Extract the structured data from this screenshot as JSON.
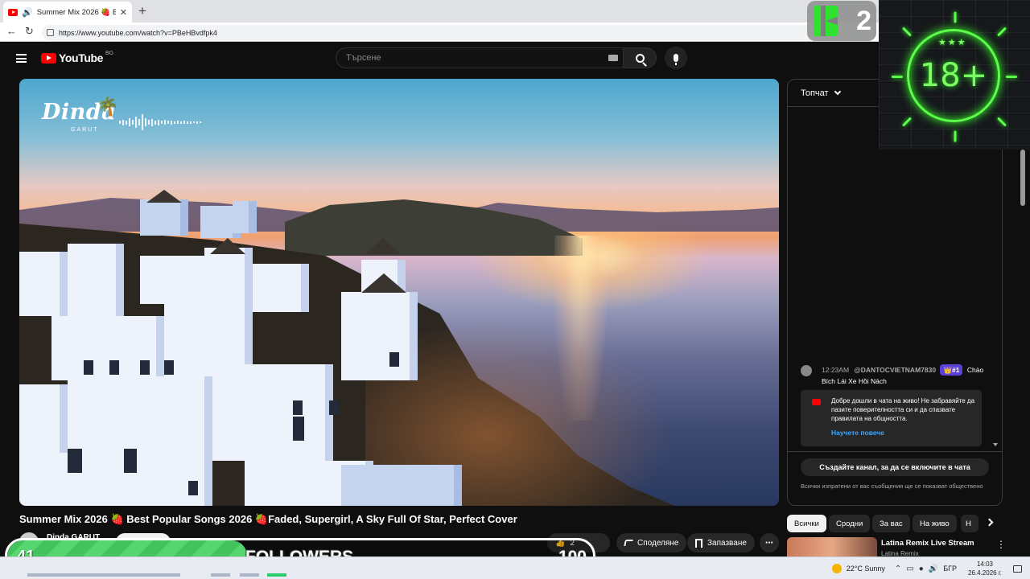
{
  "browser": {
    "tab_title": "Summer Mix 2026 🍓 Best Po",
    "tab_close": "✕",
    "new_tab": "+",
    "speaker": "🔊",
    "back": "←",
    "reload": "↻",
    "url": "https://www.youtube.com/watch?v=PBeHBvdfpk4"
  },
  "youtube": {
    "logo_text": "YouTube",
    "country_code": "BG",
    "search_placeholder": "Търсене"
  },
  "video": {
    "watermark": "Dinda",
    "watermark_sub": "GARUT",
    "title": "Summer Mix 2026 🍓 Best Popular Songs 2026 🍓Faded, Supergirl, A Sky Full Of Star, Perfect Cover",
    "channel": "Dinda GARUT",
    "like_count": "2",
    "share_label": "Споделяне",
    "save_label": "Запазване",
    "more_label": "⋯"
  },
  "chat": {
    "header": "Топчат",
    "message": {
      "time": "12:23AM",
      "author": "@DANTOCVIETNAM7830",
      "badge": "👑#1",
      "text": "Chào Bích Lái Xe Hồi Nách"
    },
    "welcome_text": "Добре дошли в чата на живо! Не забравяйте да пазите поверителността си и да спазвате правилата на общността.",
    "learn_more": "Научете повече",
    "create_channel": "Създайте канал, за да се включите в чата",
    "public_notice": "Всички изпратени от вас съобщения ще се показват обществено"
  },
  "chips": [
    "Всички",
    "Сродни",
    "За вас",
    "На живо",
    "Н"
  ],
  "active_chip": "Всички",
  "recommendation": {
    "title": "Latina Remix Live Stream",
    "channel": "Latina Remix",
    "menu": "⋮"
  },
  "overlays": {
    "k_number": "2",
    "age_rating": "18+",
    "age_stars": "★★★",
    "followers_current": "41",
    "followers_label": "FOLLOWERS",
    "followers_goal": "100",
    "followers_progress": 0.41
  },
  "taskbar": {
    "weather": "22°C  Sunny",
    "lang": "БГР",
    "time": "14:03",
    "date": "26.4.2026 г."
  },
  "colors": {
    "youtube_red": "#ff0000",
    "link_blue": "#3ea6ff",
    "neon_green": "#5bff4a",
    "progress_green": "#43c25e"
  }
}
